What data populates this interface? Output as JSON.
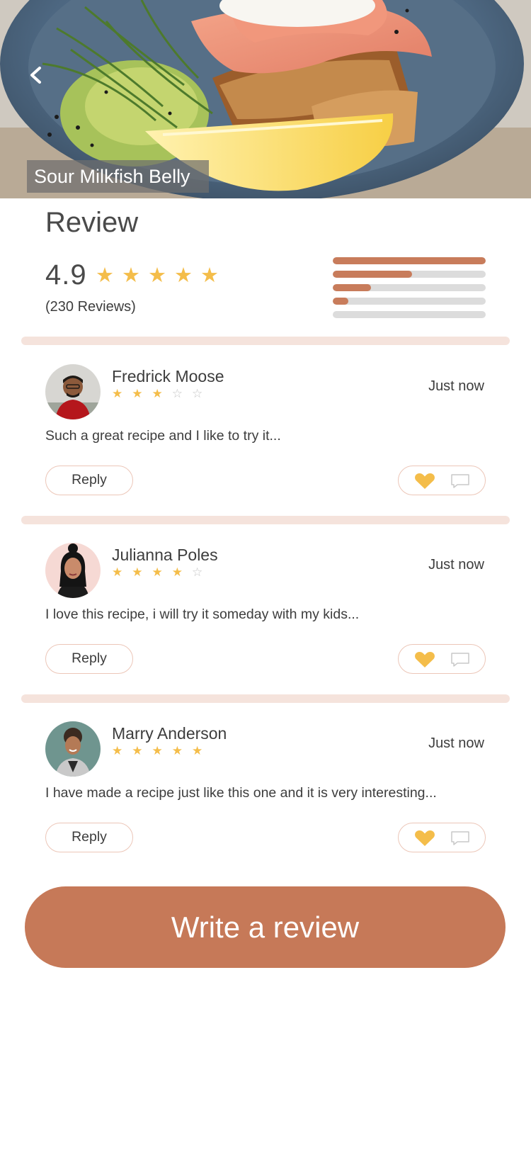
{
  "hero": {
    "title": "Sour Milkfish Belly",
    "back_icon": "chevron-left-icon"
  },
  "summary": {
    "heading": "Review",
    "rating": "4.9",
    "star_count": 5,
    "reviews_count_text": "(230 Reviews)",
    "distribution": [
      1.0,
      0.52,
      0.25,
      0.1,
      0.0
    ]
  },
  "reviews": [
    {
      "name": "Fredrick Moose",
      "rating": 3,
      "time": "Just now",
      "comment": "Such a great recipe and I like to try it...",
      "reply_label": "Reply"
    },
    {
      "name": "Julianna Poles",
      "rating": 4,
      "time": "Just now",
      "comment": "I love this recipe, i will try it someday with my kids...",
      "reply_label": "Reply"
    },
    {
      "name": "Marry Anderson",
      "rating": 5,
      "time": "Just now",
      "comment": "I have  made a recipe just like this one and it is very interesting...",
      "reply_label": "Reply"
    }
  ],
  "cta": {
    "label": "Write a review"
  },
  "colors": {
    "accent": "#c67958",
    "star": "#f4bd4a",
    "divider": "#f5e3dc",
    "button_border": "#ecc6b8"
  }
}
